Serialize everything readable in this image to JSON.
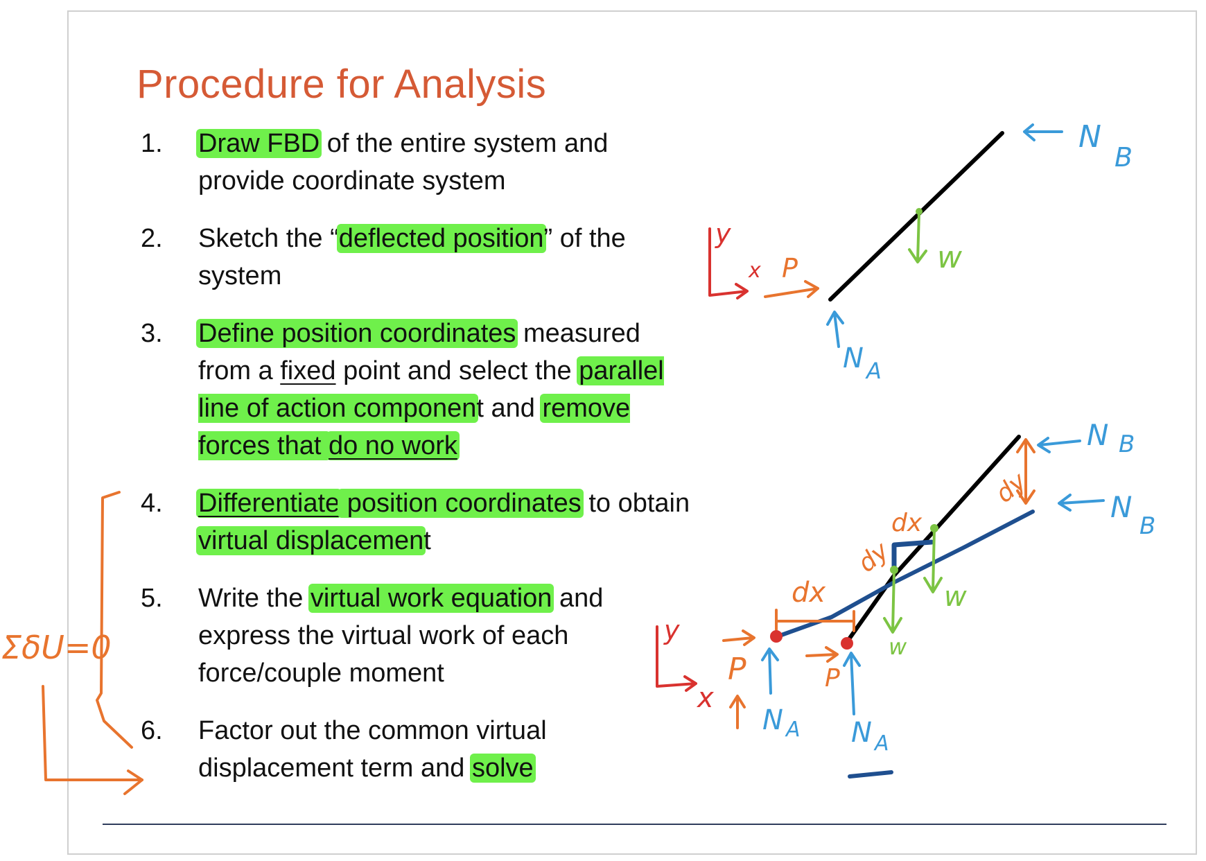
{
  "title": "Procedure for Analysis",
  "steps": [
    {
      "num": "1.",
      "parts": [
        {
          "t": "Draw FBD",
          "hl": true
        },
        {
          "t": " of the entire system and provide coordinate system"
        }
      ]
    },
    {
      "num": "2.",
      "parts": [
        {
          "t": "Sketch the “"
        },
        {
          "t": "deflected position",
          "hl": true
        },
        {
          "t": "” of the system"
        }
      ]
    },
    {
      "num": "3.",
      "parts": [
        {
          "t": "Define position coordinates",
          "hl": true
        },
        {
          "t": " measured from a "
        },
        {
          "t": "fixed",
          "ul": true
        },
        {
          "t": " point and select the "
        },
        {
          "t": "parallel line of action componen",
          "hl": true
        },
        {
          "t": "t and "
        },
        {
          "t": "remove forces that ",
          "hl": true
        },
        {
          "t": "do no work",
          "hl": true,
          "ul": true
        }
      ]
    },
    {
      "num": "4.",
      "parts": [
        {
          "t": "Differentiate",
          "hl": true,
          "ul": true
        },
        {
          "t": " position coordinates",
          "hl": true
        },
        {
          "t": " to obtain "
        },
        {
          "t": "virtual displacemen",
          "hl": true
        },
        {
          "t": "t"
        }
      ]
    },
    {
      "num": "5.",
      "parts": [
        {
          "t": "Write the "
        },
        {
          "t": "virtual work equation",
          "hl": true
        },
        {
          "t": " and express the virtual work of each force/couple moment"
        }
      ]
    },
    {
      "num": "6.",
      "parts": [
        {
          "t": "Factor out the common virtual displacement term and "
        },
        {
          "t": "solve",
          "hl": true
        }
      ]
    }
  ],
  "annotations": {
    "top_diagram": {
      "nb": "N",
      "nb_sub": "B",
      "w": "w",
      "y": "y",
      "x": "x",
      "p": "P",
      "na": "N",
      "na_sub": "A"
    },
    "bottom_diagram": {
      "nb1": "N",
      "nb1_sub": "B",
      "nb2": "N",
      "nb2_sub": "B",
      "dy_top": "dy",
      "dx_small": "dx",
      "dy_small": "dy",
      "w1": "w",
      "w2": "w",
      "dx_wide": "dx",
      "y": "y",
      "x": "x",
      "p1": "P",
      "p2": "P",
      "na1": "N",
      "na1_sub": "A",
      "na2": "N",
      "na2_sub": "A"
    },
    "margin": {
      "equation": "ΣδU=0"
    }
  },
  "colors": {
    "title": "#d55a35",
    "highlight": "#6ff04b",
    "ink_orange": "#e8742e",
    "ink_blue": "#3a9ad9",
    "ink_green": "#7cc443",
    "ink_red": "#d9322f",
    "ink_navy": "#1f4f8f",
    "ink_black": "#000000"
  }
}
